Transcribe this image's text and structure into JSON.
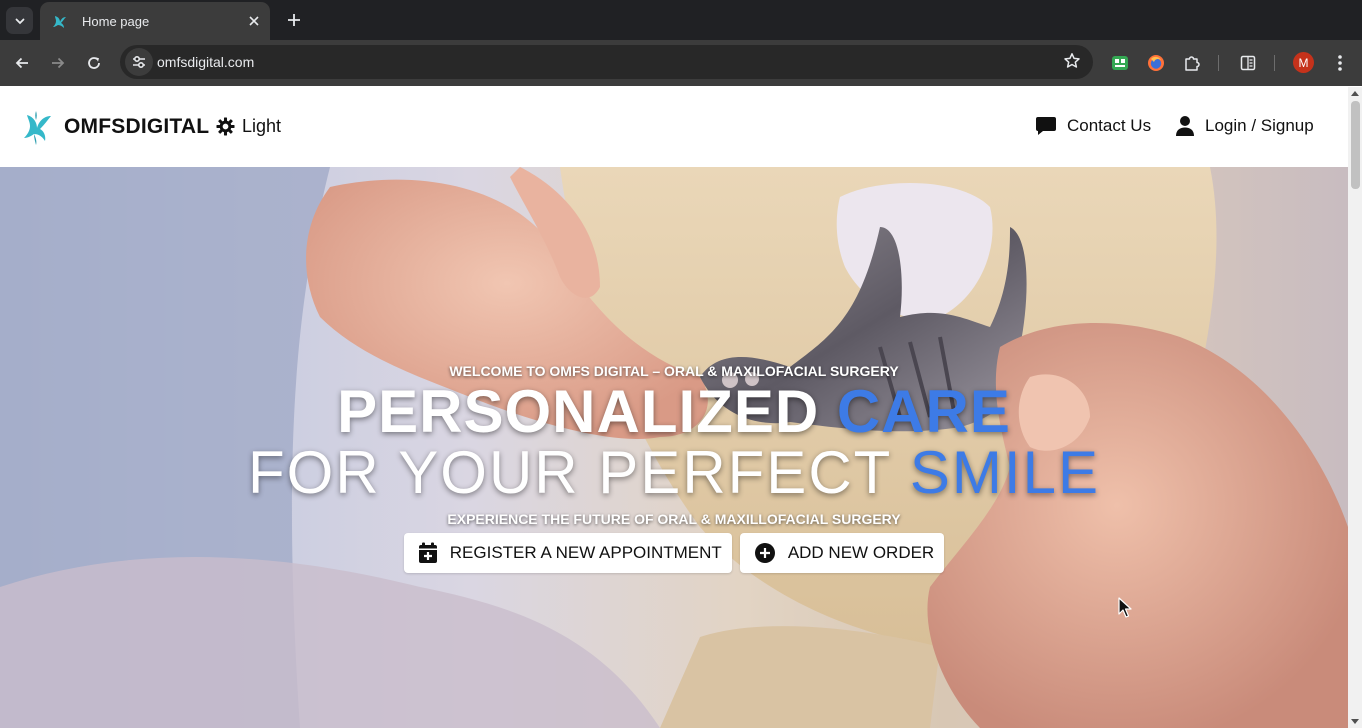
{
  "browser": {
    "tab_title": "Home page",
    "url": "omfsdigital.com",
    "profile_initial": "M"
  },
  "header": {
    "brand": "OMFSDIGITAL",
    "theme_label": "Light",
    "contact_label": "Contact Us",
    "login_label": "Login / Signup"
  },
  "hero": {
    "kicker": "WELCOME TO OMFS DIGITAL – ORAL & MAXILOFACIAL SURGERY",
    "headline_1_main": "PERSONALIZED",
    "headline_1_accent": "CARE",
    "headline_2_main": "FOR YOUR PERFECT",
    "headline_2_accent": "SMILE",
    "subheading": "EXPERIENCE THE FUTURE OF ORAL & MAXILLOFACIAL SURGERY",
    "appointment_button": "REGISTER A NEW APPOINTMENT",
    "order_button": "ADD NEW ORDER"
  },
  "colors": {
    "accent": "#3d7be6",
    "chrome_dark": "#202124",
    "chrome_toolbar": "#3c3c3c",
    "brand_teal": "#35b8c9"
  },
  "icons": {
    "theme": "gear-sun-icon",
    "contact": "chat-bubble-icon",
    "login": "user-icon",
    "appointment": "calendar-plus-icon",
    "order": "plus-circle-icon"
  }
}
